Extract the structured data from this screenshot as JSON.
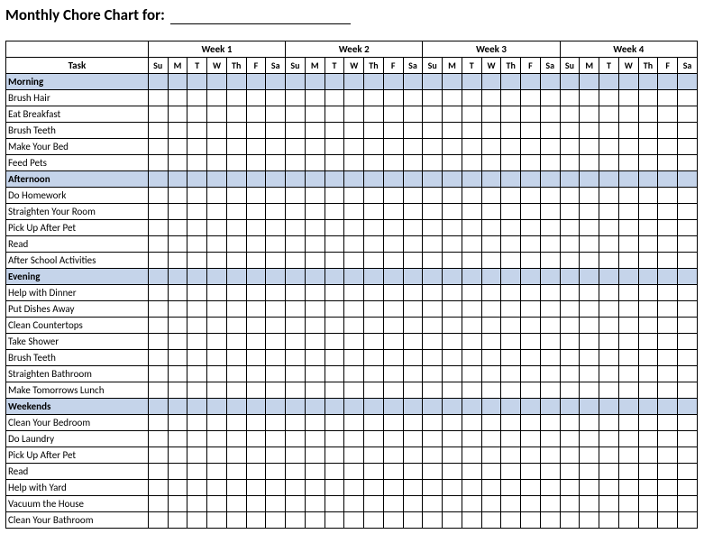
{
  "title": "Monthly Chore Chart for:",
  "task_header": "Task",
  "weeks": [
    "Week 1",
    "Week 2",
    "Week 3",
    "Week 4"
  ],
  "days": [
    "Su",
    "M",
    "T",
    "W",
    "Th",
    "F",
    "Sa"
  ],
  "sections": [
    {
      "name": "Morning",
      "tasks": [
        "Brush Hair",
        "Eat Breakfast",
        "Brush Teeth",
        "Make Your Bed",
        "Feed Pets"
      ]
    },
    {
      "name": "Afternoon",
      "tasks": [
        "Do Homework",
        "Straighten Your Room",
        "Pick Up After Pet",
        "Read",
        "After School Activities"
      ]
    },
    {
      "name": "Evening",
      "tasks": [
        "Help with Dinner",
        "Put Dishes Away",
        "Clean Countertops",
        "Take Shower",
        "Brush Teeth",
        "Straighten Bathroom",
        "Make Tomorrows Lunch"
      ]
    },
    {
      "name": "Weekends",
      "tasks": [
        "Clean Your Bedroom",
        "Do Laundry",
        "Pick Up After Pet",
        "Read",
        "Help with Yard",
        "Vacuum the House",
        "Clean Your Bathroom"
      ]
    }
  ]
}
